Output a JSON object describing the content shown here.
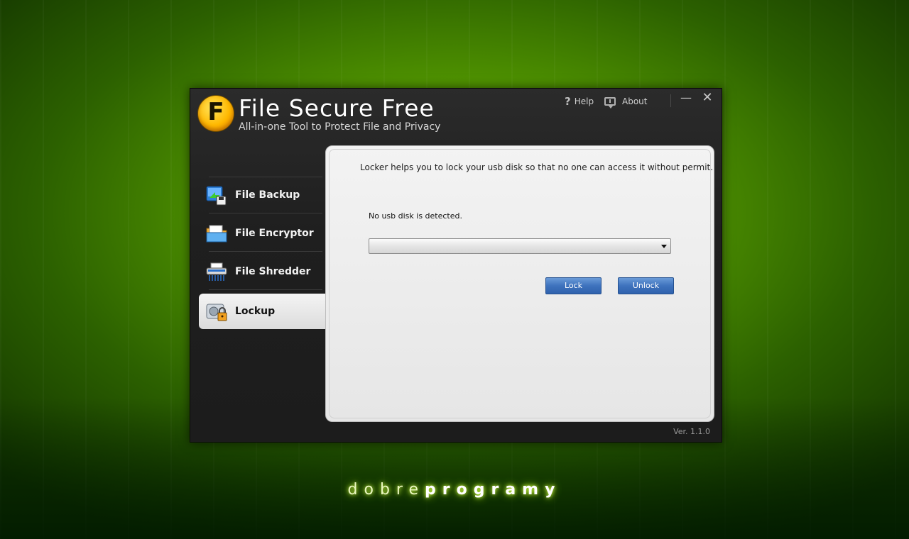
{
  "app": {
    "logo_letter": "F",
    "title": "File Secure Free",
    "subtitle": "All-in-one Tool to Protect File and Privacy",
    "version": "Ver. 1.1.0"
  },
  "topbar": {
    "help_label": "Help",
    "about_label": "About",
    "minimize_glyph": "—",
    "close_glyph": "✕"
  },
  "nav": {
    "items": [
      {
        "label": "File Backup",
        "icon": "backup-icon"
      },
      {
        "label": "File Encryptor",
        "icon": "folder-encrypt-icon"
      },
      {
        "label": "File Shredder",
        "icon": "shredder-icon"
      },
      {
        "label": "Lockup",
        "icon": "usb-lock-icon"
      }
    ],
    "active_index": 3
  },
  "panel": {
    "description": "Locker helps you to lock your usb disk so that no one can access it without permit.",
    "status": "No usb disk is detected.",
    "select_value": "",
    "lock_label": "Lock",
    "unlock_label": "Unlock"
  },
  "watermark": {
    "light": "dobre",
    "bold": "programy"
  },
  "colors": {
    "button_blue": "#3e72bd",
    "logo_yellow": "#ffb800",
    "window_bg": "#1f1f1f",
    "desktop_green": "#4f9200"
  }
}
